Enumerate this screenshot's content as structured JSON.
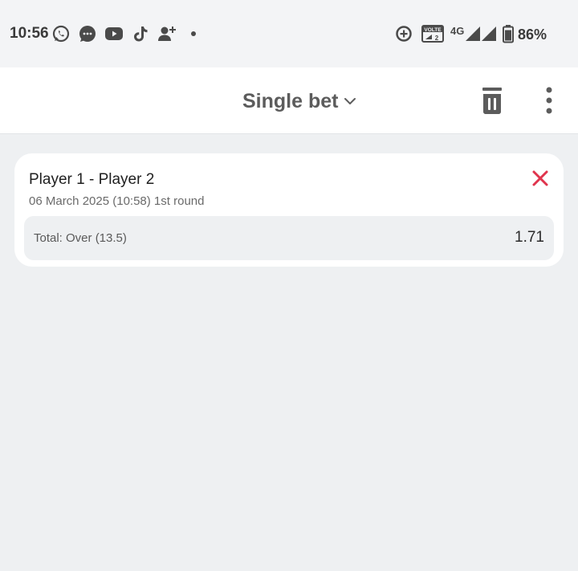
{
  "status_bar": {
    "time": "10:56",
    "left_icons": [
      "whatsapp-icon",
      "messages-icon",
      "youtube-icon",
      "tiktok-icon",
      "add-person-icon"
    ],
    "right_icons": [
      "data-saver-icon",
      "volte-icon",
      "signal-icon",
      "battery-icon"
    ],
    "volte_label": "VOLTE",
    "network_label": "4G",
    "battery": "86%"
  },
  "header": {
    "bet_type_label": "Single bet",
    "actions": [
      "trash-icon",
      "more-vertical-icon"
    ]
  },
  "bet_slip": {
    "match": "Player 1 - Player 2",
    "info": "06 March 2025 (10:58) 1st round",
    "outcome": "Total: Over (13.5)",
    "odds": "1.71"
  },
  "colors": {
    "background": "#eef0f2",
    "card": "#ffffff",
    "close_accent": "#e0344d",
    "header_text": "#5c5c5c"
  }
}
